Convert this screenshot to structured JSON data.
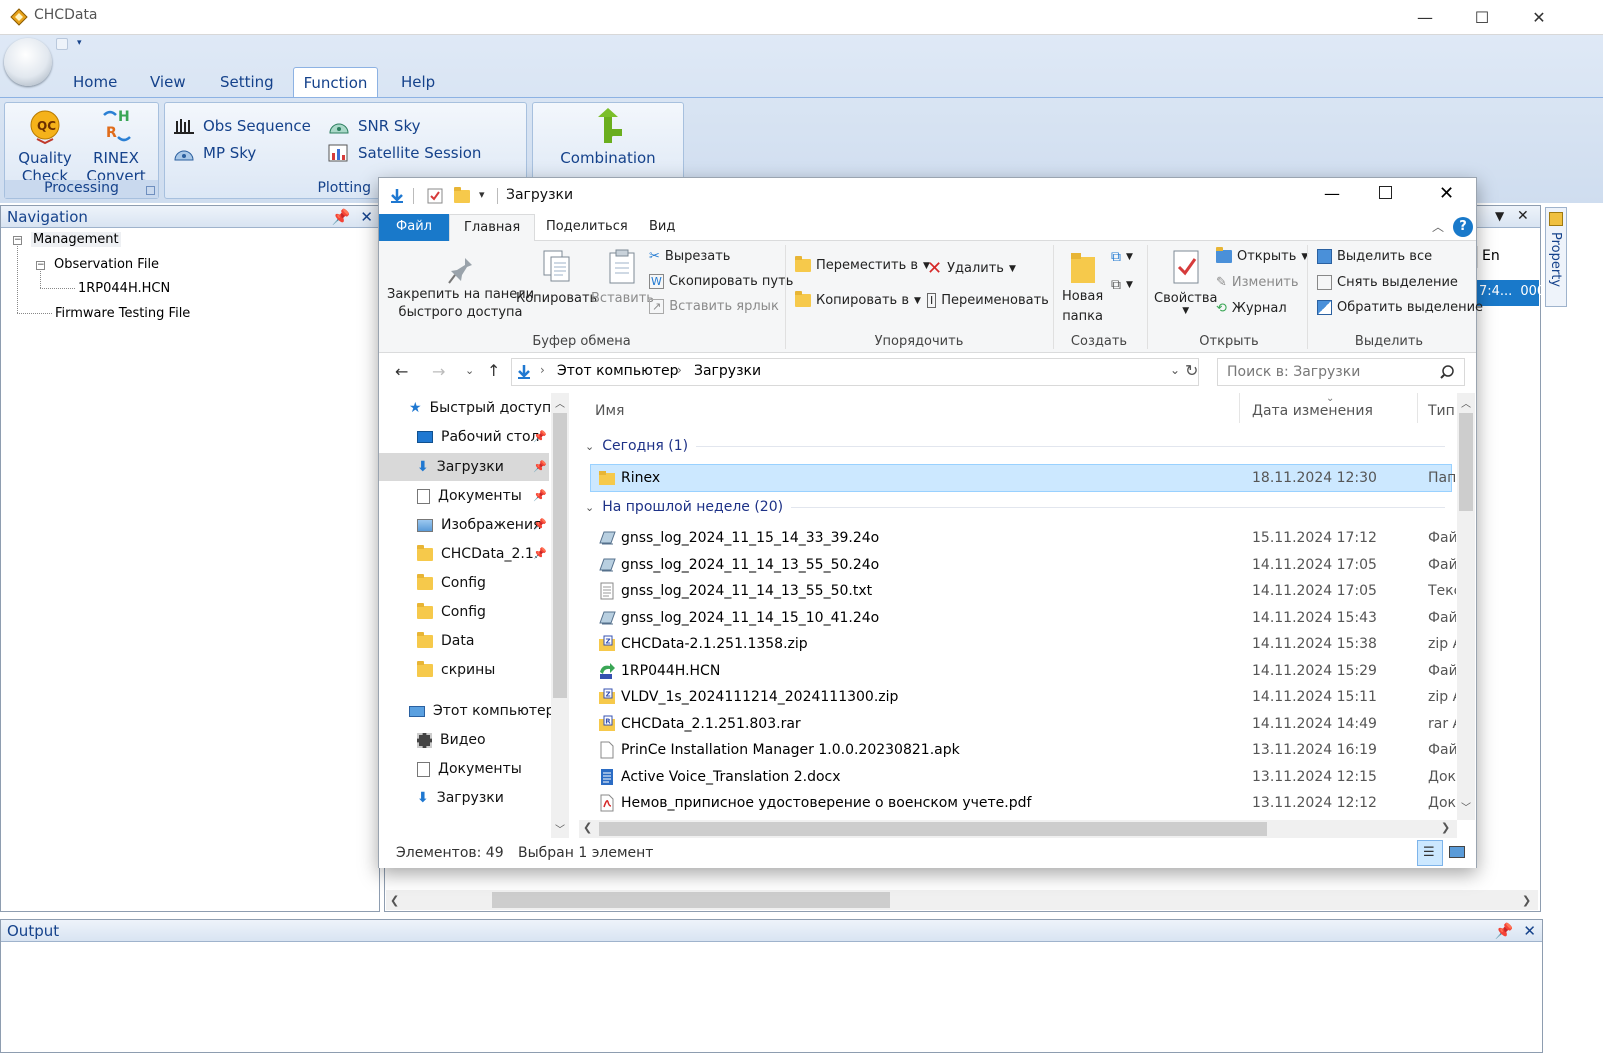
{
  "app": {
    "title": "CHCData",
    "window_controls": {
      "minimize": "—",
      "maximize": "☐",
      "close": "✕"
    }
  },
  "ribbon": {
    "tabs": [
      "Home",
      "View",
      "Setting",
      "Function",
      "Help"
    ],
    "active_tab": "Function",
    "processing": {
      "label": "Processing",
      "quality_check": [
        "Quality",
        "Check"
      ],
      "rinex_convert": [
        "RINEX",
        "Convert"
      ]
    },
    "plotting": {
      "label": "Plotting",
      "obs_sequence": "Obs Sequence",
      "mp_sky": "MP Sky",
      "snr_sky": "SNR Sky",
      "satellite_session": "Satellite Session"
    },
    "combination": "Combination"
  },
  "navigation": {
    "title": "Navigation",
    "tree": {
      "management": "Management",
      "observation_file": "Observation File",
      "file_1": "1RP044H.HCN",
      "firmware_testing_file": "Firmware Testing File"
    }
  },
  "background_doc": {
    "header_fragment": "En",
    "row_cell_1": "7:4...",
    "row_cell_2": "000"
  },
  "property_tab": "Property",
  "output": {
    "title": "Output"
  },
  "explorer": {
    "title": "Загрузки",
    "tabs": [
      "Файл",
      "Главная",
      "Поделиться",
      "Вид"
    ],
    "ribbon": {
      "pin_label": [
        "Закрепить на панели",
        "быстрого доступа"
      ],
      "copy": "Копировать",
      "paste": "Вставить",
      "cut": "Вырезать",
      "copy_path": "Скопировать путь",
      "paste_shortcut": "Вставить ярлык",
      "clipboard_group": "Буфер обмена",
      "move_to": "Переместить в",
      "copy_to": "Копировать в",
      "delete": "Удалить",
      "rename": "Переименовать",
      "organize_group": "Упорядочить",
      "new_folder": [
        "Новая",
        "папка"
      ],
      "create_group": "Создать",
      "properties": "Свойства",
      "open": "Открыть",
      "edit": "Изменить",
      "history": "Журнал",
      "open_group": "Открыть",
      "select_all": "Выделить все",
      "select_none": "Снять выделение",
      "invert_selection": "Обратить выделение",
      "select_group": "Выделить"
    },
    "address": {
      "crumbs": [
        "Этот компьютер",
        "Загрузки"
      ],
      "search_placeholder": "Поиск в: Загрузки"
    },
    "nav_pane": {
      "quick_access": "Быстрый доступ",
      "items": [
        "Рабочий стол",
        "Загрузки",
        "Документы",
        "Изображения",
        "CHCData_2.1.",
        "Config",
        "Config",
        "Data",
        "скрины"
      ],
      "this_pc": "Этот компьютер",
      "pc_items": [
        "Видео",
        "Документы",
        "Загрузки"
      ]
    },
    "columns": {
      "name": "Имя",
      "date": "Дата изменения",
      "type": "Тип"
    },
    "groups": {
      "today": "Сегодня (1)",
      "last_week": "На прошлой неделе (20)"
    },
    "today_files": [
      {
        "name": "Rinex",
        "date": "18.11.2024 12:30",
        "type": "Пап",
        "icon": "folder"
      }
    ],
    "week_files": [
      {
        "name": "gnss_log_2024_11_15_14_33_39.24o",
        "date": "15.11.2024 17:12",
        "type": "Фай",
        "icon": "file-o"
      },
      {
        "name": "gnss_log_2024_11_14_13_55_50.24o",
        "date": "14.11.2024 17:05",
        "type": "Фай",
        "icon": "file-o"
      },
      {
        "name": "gnss_log_2024_11_14_13_55_50.txt",
        "date": "14.11.2024 17:05",
        "type": "Текс",
        "icon": "txt"
      },
      {
        "name": "gnss_log_2024_11_14_15_10_41.24o",
        "date": "14.11.2024 15:43",
        "type": "Фай",
        "icon": "file-o"
      },
      {
        "name": "CHCData-2.1.251.1358.zip",
        "date": "14.11.2024 15:38",
        "type": "zip A",
        "icon": "zip"
      },
      {
        "name": "1RP044H.HCN",
        "date": "14.11.2024 15:29",
        "type": "Фай",
        "icon": "hcn"
      },
      {
        "name": "VLDV_1s_2024111214_2024111300.zip",
        "date": "14.11.2024 15:11",
        "type": "zip A",
        "icon": "zip"
      },
      {
        "name": "CHCData_2.1.251.803.rar",
        "date": "14.11.2024 14:49",
        "type": "rar A",
        "icon": "rar"
      },
      {
        "name": "PrinCe Installation Manager 1.0.0.20230821.apk",
        "date": "13.11.2024 16:19",
        "type": "Фай",
        "icon": "blank"
      },
      {
        "name": "Active Voice_Translation 2.docx",
        "date": "13.11.2024 12:15",
        "type": "Доку",
        "icon": "docx"
      },
      {
        "name": "Немов_приписное удостоверение о военском учете.pdf",
        "date": "13.11.2024 12:12",
        "type": "Доку",
        "icon": "pdf"
      }
    ],
    "status": {
      "count": "Элементов: 49",
      "selected": "Выбран 1 элемент"
    },
    "colors": {
      "accent": "#1979ca",
      "selection": "#cce8ff",
      "group_text": "#1e3287"
    }
  }
}
